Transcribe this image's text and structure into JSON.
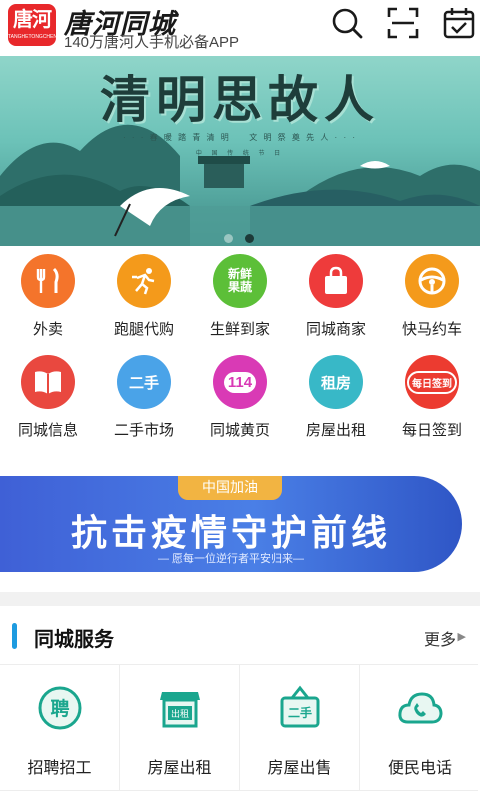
{
  "header": {
    "logo_text": "唐河",
    "logo_small": "TANGHETONGCHENG",
    "brand": "唐河同城",
    "tagline": "140万唐河人手机必备APP",
    "icons": [
      "search-icon",
      "scan-icon",
      "checkin-calendar-icon"
    ]
  },
  "banner": {
    "title": "清明思故人",
    "subtitle": "· · · 春 暖 踏 青 清 明 　 文 明 祭 奠 先 人 · · ·",
    "subtitle2": "中 国 传 统 节 日",
    "colors": {
      "sky": "#8fd5c9",
      "mountain": "#2e6f6a",
      "water": "#5fb1a8"
    },
    "active_dot": 1
  },
  "grid": [
    {
      "label": "外卖",
      "icon": "fork-knife-icon",
      "color": "#f4742b"
    },
    {
      "label": "跑腿代购",
      "icon": "runner-icon",
      "color": "#f49a1b"
    },
    {
      "label": "生鲜到家",
      "icon": "fresh-produce-icon",
      "color": "#5cbf38",
      "text": "新鲜果蔬"
    },
    {
      "label": "同城商家",
      "icon": "shopping-bag-icon",
      "color": "#ee3b3b"
    },
    {
      "label": "快马约车",
      "icon": "steering-wheel-icon",
      "color": "#f49a1b"
    },
    {
      "label": "同城信息",
      "icon": "book-icon",
      "color": "#e9483f"
    },
    {
      "label": "二手市场",
      "icon": "second-hand-icon",
      "color": "#4aa3e8",
      "text": "二手"
    },
    {
      "label": "同城黄页",
      "icon": "yellow-pages-icon",
      "color": "#d93ab5",
      "text": "114"
    },
    {
      "label": "房屋出租",
      "icon": "house-rent-icon",
      "color": "#38b8c7",
      "text": "租房"
    },
    {
      "label": "每日签到",
      "icon": "daily-checkin-icon",
      "color": "#ec3b30",
      "text": "每日签到"
    }
  ],
  "promo": {
    "tag": "中国加油",
    "title": "抗击疫情守护前线",
    "subtitle": "— 愿每一位逆行者平安归来—"
  },
  "services": {
    "title": "同城服务",
    "more": "更多",
    "items": [
      {
        "label": "招聘招工",
        "icon": "hire-icon",
        "text": "聘"
      },
      {
        "label": "房屋出租",
        "icon": "house-rent-shop-icon",
        "text": "出租"
      },
      {
        "label": "房屋出售",
        "icon": "house-sale-sign-icon",
        "text": "二手"
      },
      {
        "label": "便民电话",
        "icon": "phone-cloud-icon"
      }
    ],
    "accent": "#1e9be0",
    "icon_color": "#1aa68e"
  }
}
